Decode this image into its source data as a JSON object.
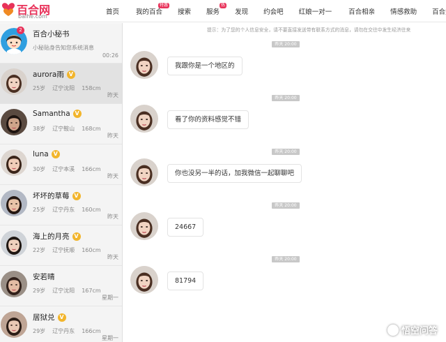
{
  "brand": {
    "name_cn": "百合网",
    "name_en": "baihe.com",
    "color": "#e8325a"
  },
  "nav": {
    "items": [
      {
        "label": "首页",
        "badge": ""
      },
      {
        "label": "我的百合",
        "badge": "特惠"
      },
      {
        "label": "搜索",
        "badge": ""
      },
      {
        "label": "服务",
        "badge": "热"
      },
      {
        "label": "发现",
        "badge": ""
      },
      {
        "label": "约会吧",
        "badge": ""
      },
      {
        "label": "红娘一对一",
        "badge": ""
      },
      {
        "label": "百合相亲",
        "badge": ""
      },
      {
        "label": "情感救助",
        "badge": ""
      },
      {
        "label": "百合婚礼",
        "badge": ""
      }
    ]
  },
  "contacts": [
    {
      "name": "百合小秘书",
      "info": "小秘贴身告知您系统消息",
      "age": "",
      "city": "",
      "height": "",
      "time": "00:26",
      "unread": "2",
      "vip": false,
      "avatar": "assistant-avatar"
    },
    {
      "name": "aurora雨",
      "info": "",
      "age": "25岁",
      "city": "辽宁沈阳",
      "height": "158cm",
      "time": "昨天",
      "unread": "",
      "vip": true,
      "avatar": "user-photo"
    },
    {
      "name": "Samantha",
      "info": "",
      "age": "38岁",
      "city": "辽宁鞍山",
      "height": "168cm",
      "time": "昨天",
      "unread": "",
      "vip": true,
      "avatar": "user-photo"
    },
    {
      "name": "luna",
      "info": "",
      "age": "30岁",
      "city": "辽宁本溪",
      "height": "166cm",
      "time": "昨天",
      "unread": "",
      "vip": true,
      "avatar": "user-photo"
    },
    {
      "name": "坏坏的草莓",
      "info": "",
      "age": "25岁",
      "city": "辽宁丹东",
      "height": "160cm",
      "time": "昨天",
      "unread": "",
      "vip": true,
      "avatar": "user-photo"
    },
    {
      "name": "海上的月亮",
      "info": "",
      "age": "22岁",
      "city": "辽宁抚顺",
      "height": "160cm",
      "time": "昨天",
      "unread": "",
      "vip": true,
      "avatar": "user-photo"
    },
    {
      "name": "安若晴",
      "info": "",
      "age": "29岁",
      "city": "辽宁沈阳",
      "height": "167cm",
      "time": "星期一",
      "unread": "",
      "vip": false,
      "avatar": "user-photo"
    },
    {
      "name": "居狱兑",
      "info": "",
      "age": "29岁",
      "city": "辽宁丹东",
      "height": "166cm",
      "time": "星期一",
      "unread": "",
      "vip": true,
      "avatar": "user-photo"
    }
  ],
  "chat": {
    "notice": "提示：为了您的个人信息安全，请不要直接发送带有联系方式的消息，请勿在交往中发生经济往来",
    "messages": [
      {
        "time": "昨天 20:00",
        "text": "我跟你是一个地区的"
      },
      {
        "time": "昨天 20:00",
        "text": "看了你的资料感觉不错"
      },
      {
        "time": "昨天 20:00",
        "text": "你也没另一半的话，加我微信一起聊聊吧"
      },
      {
        "time": "昨天 20:00",
        "text": "24667"
      },
      {
        "time": "昨天 20:00",
        "text": "81794"
      }
    ]
  },
  "watermark": "悟空问答"
}
